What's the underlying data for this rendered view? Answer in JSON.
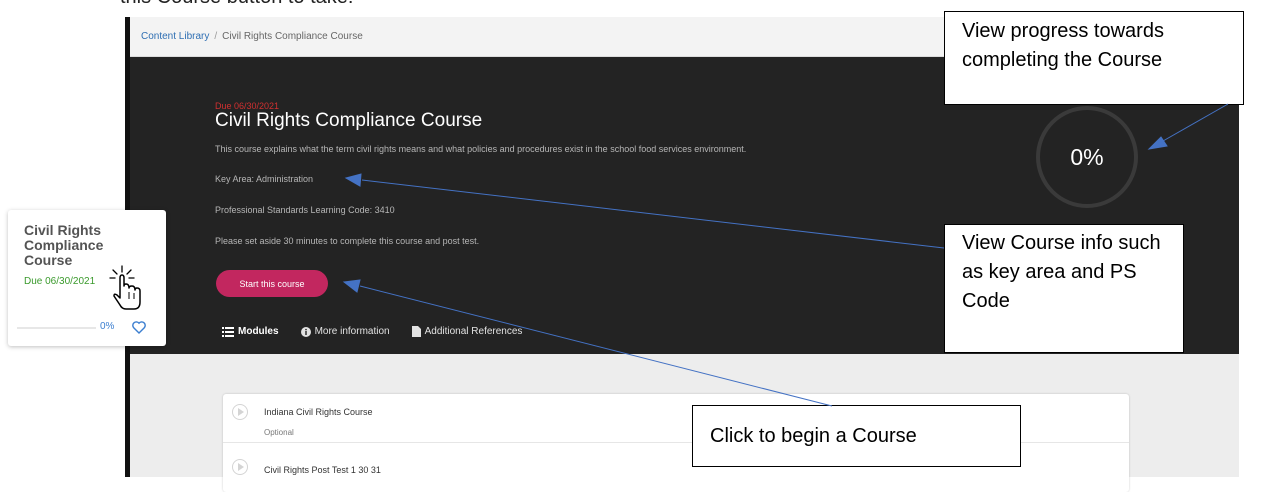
{
  "doc": {
    "top_text": "this Course button to take:"
  },
  "breadcrumb": {
    "link": "Content Library",
    "separator": "/",
    "current": "Civil Rights Compliance Course"
  },
  "course": {
    "due": "Due 06/30/2021",
    "title": "Civil Rights Compliance Course",
    "description": "This course explains what the term civil rights means and what policies and procedures exist in the school food services environment.",
    "key_area": "Key Area: Administration",
    "ps_code": "Professional Standards Learning Code: 3410",
    "set_aside": "Please set aside 30 minutes to complete this course and post test.",
    "start_label": "Start this course",
    "progress_pct": "0%",
    "progress_value": 0
  },
  "tabs": [
    {
      "label": "Modules",
      "icon": "list-icon",
      "active": true
    },
    {
      "label": "More information",
      "icon": "info-icon",
      "active": false
    },
    {
      "label": "Additional References",
      "icon": "document-icon",
      "active": false
    }
  ],
  "modules": [
    {
      "name": "Indiana Civil Rights Course",
      "status": "Optional"
    },
    {
      "name": "Civil Rights Post Test 1 30 31",
      "status": ""
    }
  ],
  "card": {
    "title": "Civil Rights Compliance Course",
    "due": "Due 06/30/2021",
    "pct": "0%",
    "icon": "heart-icon"
  },
  "callouts": {
    "progress": "View progress towards completing the Course",
    "info": "View Course info such as key area and PS Code",
    "begin": "Click to begin a Course"
  },
  "colors": {
    "hero_bg": "#232323",
    "accent_button": "#c2275f",
    "due_red": "#d03030",
    "due_green": "#3a9a2c",
    "arrow_blue": "#4472c4"
  }
}
